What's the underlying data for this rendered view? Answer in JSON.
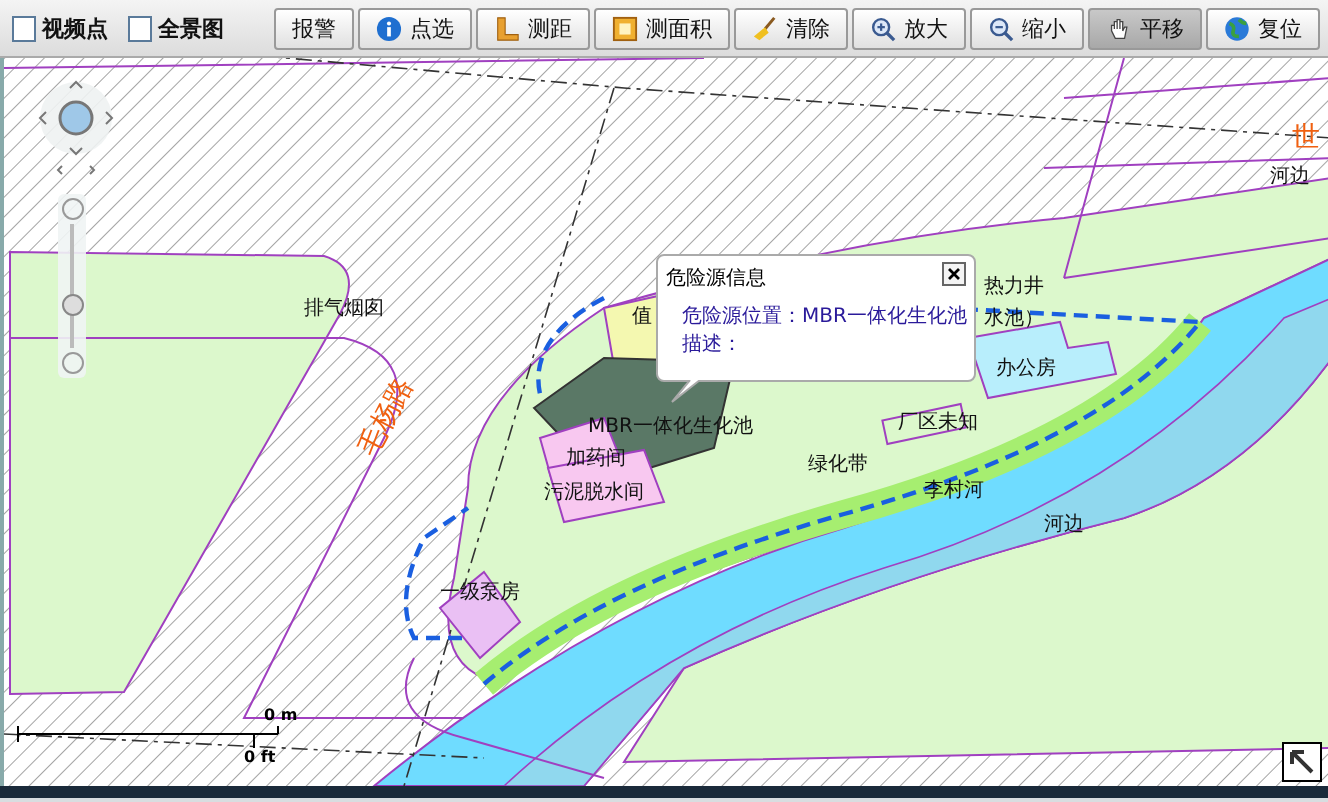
{
  "toolbar": {
    "checkboxes": [
      {
        "label": "视频点",
        "checked": false
      },
      {
        "label": "全景图",
        "checked": false
      }
    ],
    "buttons": [
      {
        "label": "报警",
        "kind": "plain",
        "selected": false
      },
      {
        "label": "点选",
        "kind": "info",
        "selected": false
      },
      {
        "label": "测距",
        "kind": "ruler",
        "selected": false
      },
      {
        "label": "测面积",
        "kind": "area",
        "selected": false
      },
      {
        "label": "清除",
        "kind": "broom",
        "selected": false
      },
      {
        "label": "放大",
        "kind": "zoomin",
        "selected": false
      },
      {
        "label": "缩小",
        "kind": "zoomout",
        "selected": false
      },
      {
        "label": "平移",
        "kind": "hand",
        "selected": true
      },
      {
        "label": "复位",
        "kind": "globe",
        "selected": false
      }
    ]
  },
  "map": {
    "zoom_slider": {
      "level": 0.32
    },
    "labels": [
      {
        "text": "世",
        "kind": "landmark"
      },
      {
        "text": "河边",
        "kind": "plain"
      },
      {
        "text": "热力井",
        "kind": "plain"
      },
      {
        "text": "排气烟囱",
        "kind": "plain"
      },
      {
        "text": "值",
        "kind": "plain"
      },
      {
        "text": "水池）",
        "kind": "plain"
      },
      {
        "text": "办公房",
        "kind": "plain"
      },
      {
        "text": "MBR一体化生化池",
        "kind": "plain"
      },
      {
        "text": "厂区未知",
        "kind": "plain"
      },
      {
        "text": "毛杨路",
        "kind": "road"
      },
      {
        "text": "加药间",
        "kind": "plain"
      },
      {
        "text": "绿化带",
        "kind": "plain"
      },
      {
        "text": "污泥脱水间",
        "kind": "plain"
      },
      {
        "text": "李村河",
        "kind": "plain"
      },
      {
        "text": "河边",
        "kind": "plain"
      },
      {
        "text": "一级泵房",
        "kind": "plain"
      }
    ],
    "popup": {
      "title": "危险源信息",
      "lines": [
        "危险源位置：MBR一体化生化池",
        "描述："
      ]
    },
    "scale": {
      "metric": "0 m",
      "imperial": "0 ft"
    }
  }
}
